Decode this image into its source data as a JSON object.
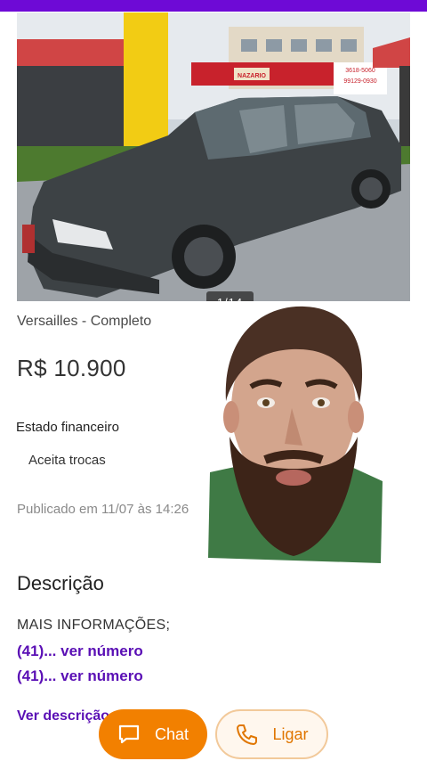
{
  "gallery": {
    "counter": "1/14",
    "sign_lines": [
      "3618-5060",
      "99129-0930"
    ],
    "sign_brand": "NAZARIO"
  },
  "listing": {
    "title": "Versailles - Completo",
    "price": "R$ 10.900",
    "financial_label": "Estado financeiro",
    "financial_value": "Aceita trocas",
    "published": "Publicado em 11/07 às 14:26"
  },
  "description": {
    "heading": "Descrição",
    "line": "MAIS INFORMAÇÕES;",
    "phones": [
      "(41)... ver número",
      "(41)... ver número"
    ],
    "more_link": "Ver descrição"
  },
  "actions": {
    "chat_label": "Chat",
    "call_label": "Ligar"
  },
  "colors": {
    "brand_purple": "#6e0ad6",
    "link_purple": "#5a0fb5",
    "cta_orange": "#f28000"
  },
  "icons": {
    "chat": "chat-bubble-icon",
    "call": "phone-icon"
  }
}
